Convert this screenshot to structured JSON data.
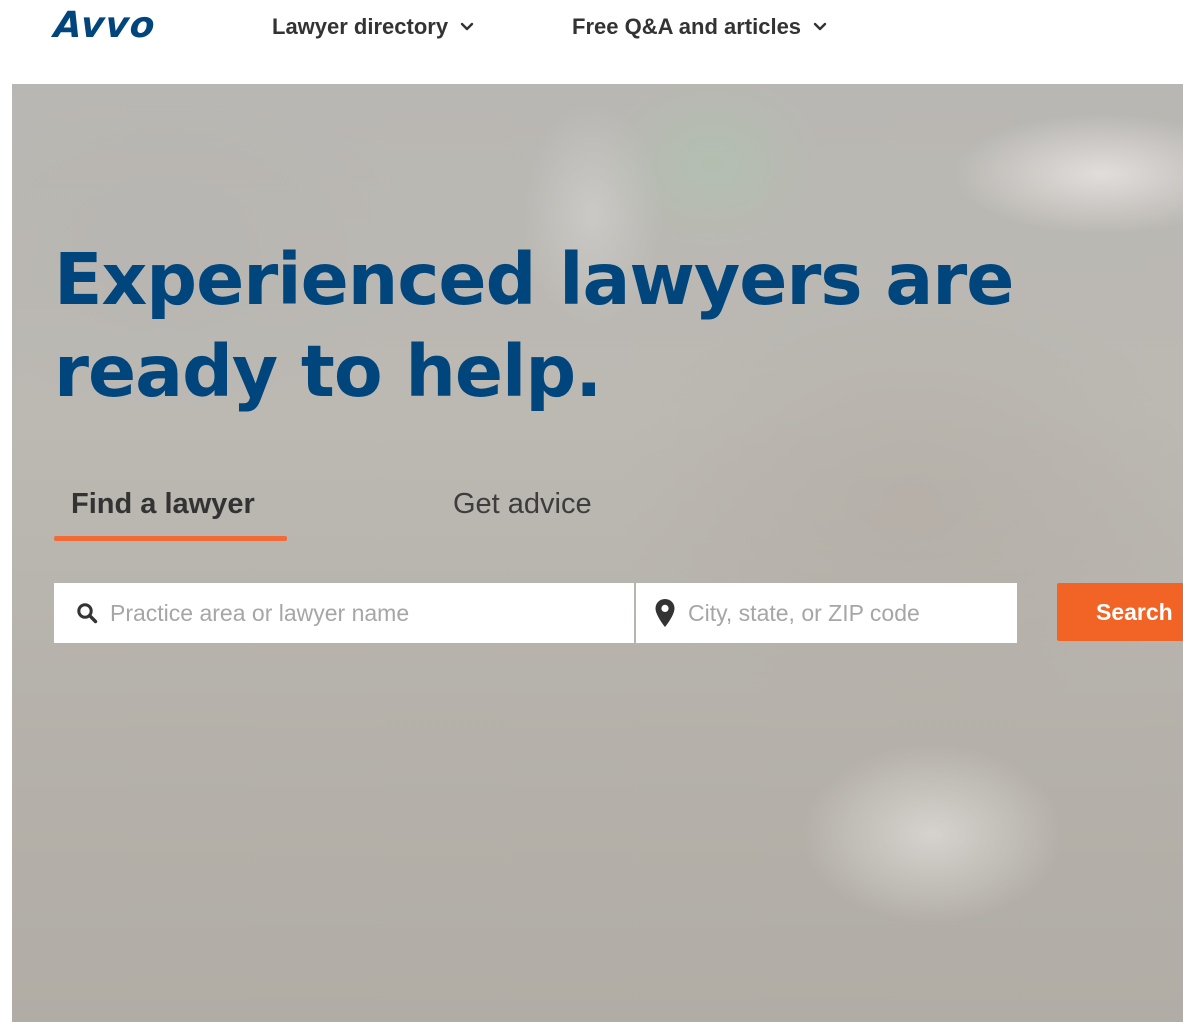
{
  "brand": {
    "logo_text": "Avvo",
    "primary_color": "#00457c",
    "accent_color": "#f26326"
  },
  "nav": {
    "items": [
      {
        "label": "Lawyer directory",
        "icon": "chevron-down-icon"
      },
      {
        "label": "Free Q&A and articles",
        "icon": "chevron-down-icon"
      }
    ]
  },
  "hero": {
    "headline_line1": "Experienced lawyers are",
    "headline_line2": "ready to help.",
    "tabs": [
      {
        "label": "Find a lawyer",
        "active": true
      },
      {
        "label": "Get advice",
        "active": false
      }
    ],
    "search": {
      "practice_placeholder": "Practice area or lawyer name",
      "practice_value": "",
      "practice_icon": "search-icon",
      "location_placeholder": "City, state, or ZIP code",
      "location_value": "",
      "location_icon": "map-pin-icon",
      "button_label": "Search"
    }
  }
}
